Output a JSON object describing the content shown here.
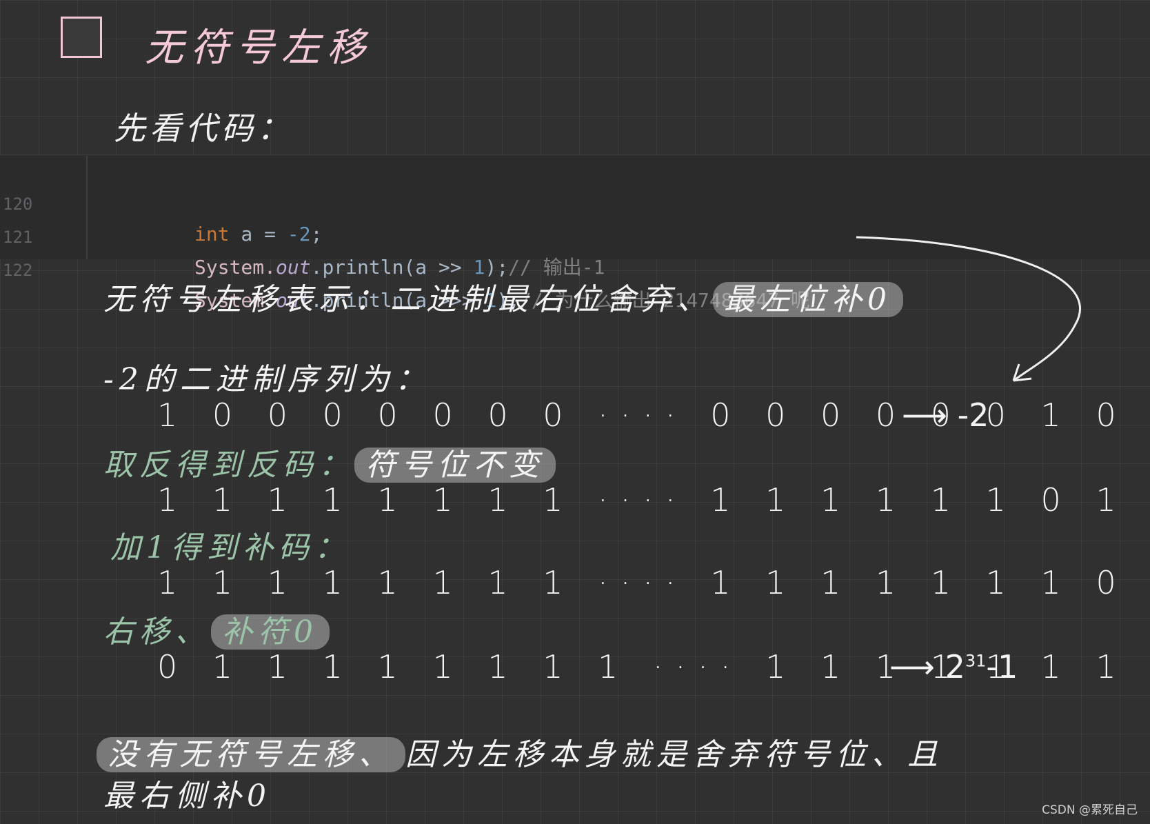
{
  "title": "无符号左移",
  "intro": "先看代码：",
  "code": {
    "lines": [
      {
        "num": "120",
        "kw": "int",
        "rest": " a = ",
        "num_val": "-2",
        "tail": ";"
      },
      {
        "num": "121",
        "cls": "System.",
        "fld": "out",
        "mid": ".println(a >> ",
        "num_val": "1",
        "tail": ");",
        "comment": "// 输出-1"
      },
      {
        "num": "122",
        "cls": "System.",
        "fld": "out",
        "mid": ".println(a >>> ",
        "num_val": "1",
        "tail": ");",
        "comment": "// 为什么输出 2147483647 呢"
      }
    ]
  },
  "notes": {
    "definition_pre": "无符号左移表示：二进制最右位舍弃、",
    "definition_hl": "最左位补0",
    "binary_label": "-2的二进制序列为：",
    "bits_original": "1 0 0 0 0 0 0 0 ···· 0 0 0 0 0 0 1 0",
    "original_value": "⟶ -2",
    "ones_label": "取反得到反码：",
    "ones_hl": "符号位不变",
    "bits_ones": "1 1 1 1 1 1 1 1 ···· 1 1 1 1 1 1 0 1",
    "twos_label": "加1得到补码：",
    "bits_twos": "1 1 1 1 1 1 1 1 ···· 1 1 1 1 1 1 1 0",
    "shift_label": "右移、",
    "shift_hl": "补符0",
    "bits_shift": "0 1 1 1 1 1 1 1 1 ···· 1 1 1 1 1 1 1",
    "result_pre": "⟶ 2",
    "result_exp": "31",
    "result_post": "-1",
    "conclusion_hl": "没有无符号左移、",
    "conclusion_rest": "因为左移本身就是舍弃符号位、且",
    "conclusion_line2": "最右侧补0"
  },
  "watermark": "CSDN @累死自己"
}
